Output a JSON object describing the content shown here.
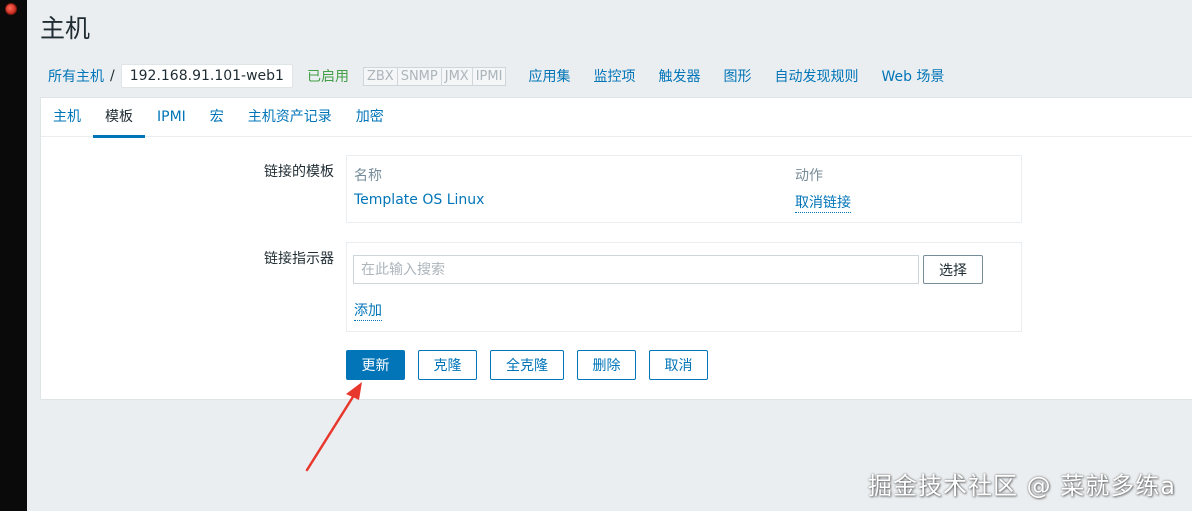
{
  "page": {
    "title": "主机"
  },
  "breadcrumb": {
    "all_hosts": "所有主机",
    "separator": "/",
    "current_host": "192.168.91.101-web1"
  },
  "status": {
    "enabled_label": "已启用",
    "availability": [
      "ZBX",
      "SNMP",
      "JMX",
      "IPMI"
    ]
  },
  "nav_links": [
    "应用集",
    "监控项",
    "触发器",
    "图形",
    "自动发现规则",
    "Web 场景"
  ],
  "tabs": [
    {
      "label": "主机",
      "active": false
    },
    {
      "label": "模板",
      "active": true
    },
    {
      "label": "IPMI",
      "active": false
    },
    {
      "label": "宏",
      "active": false
    },
    {
      "label": "主机资产记录",
      "active": false
    },
    {
      "label": "加密",
      "active": false
    }
  ],
  "linked_templates": {
    "label": "链接的模板",
    "columns": [
      "名称",
      "动作"
    ],
    "rows": [
      {
        "name": "Template OS Linux",
        "action": "取消链接"
      }
    ]
  },
  "link_new": {
    "label": "链接指示器",
    "search_placeholder": "在此输入搜索",
    "select_button": "选择",
    "add_link": "添加"
  },
  "actions": {
    "update": "更新",
    "clone": "克隆",
    "full_clone": "全克隆",
    "delete": "删除",
    "cancel": "取消"
  },
  "watermark": "掘金技术社区 @ 菜就多练a",
  "colors": {
    "link": "#0275b8",
    "enabled": "#429e47",
    "primary_button": "#0275b8",
    "annotation_arrow": "#e8372c"
  }
}
